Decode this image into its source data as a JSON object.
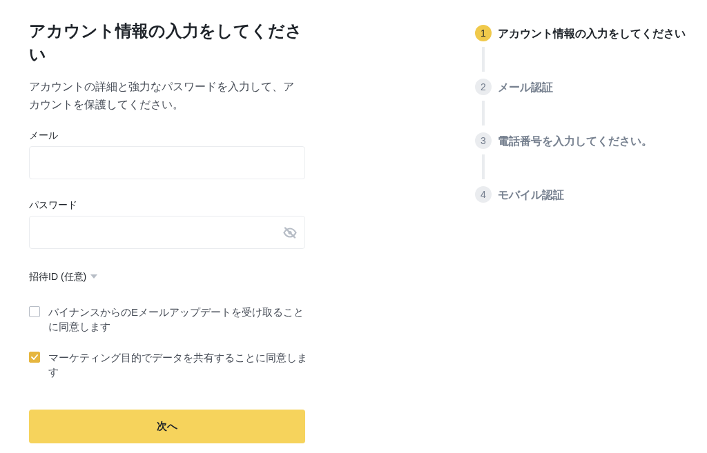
{
  "form": {
    "title": "アカウント情報の入力をしてください",
    "subtitle": "アカウントの詳細と強力なパスワードを入力して、アカウントを保護してください。",
    "fields": [
      {
        "label": "メール",
        "kind": "text"
      },
      {
        "label": "パスワード",
        "kind": "password"
      }
    ],
    "referral": {
      "label": "招待ID (任意)",
      "expanded": false
    },
    "consents": [
      {
        "label": "バイナンスからのEメールアップデートを受け取ることに同意します",
        "checked": false
      },
      {
        "label": "マーケティング目的でデータを共有することに同意します",
        "checked": true
      }
    ],
    "submit_button": "次へ"
  },
  "steps": [
    {
      "number": "1",
      "label": "アカウント情報の入力をしてください",
      "selected": true
    },
    {
      "number": "2",
      "label": "メール認証",
      "selected": false
    },
    {
      "number": "3",
      "label": "電話番号を入力してください。",
      "selected": false
    },
    {
      "number": "4",
      "label": "モバイル認証",
      "selected": false
    }
  ]
}
